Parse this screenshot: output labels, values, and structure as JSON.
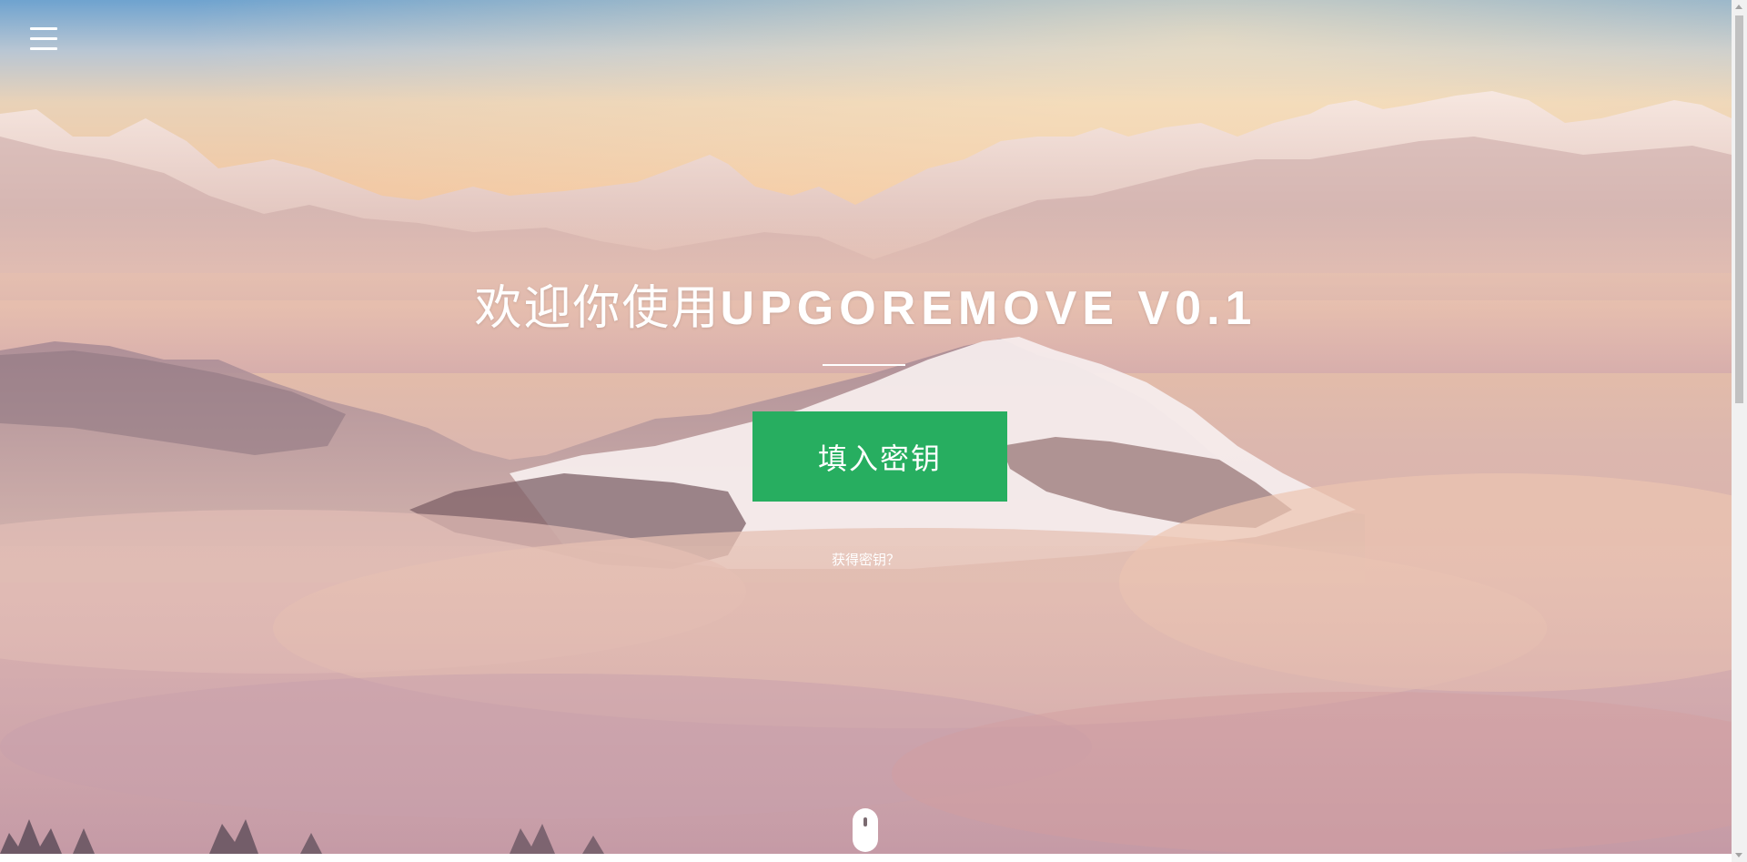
{
  "header": {
    "menu_icon": "hamburger-menu-icon"
  },
  "hero": {
    "title_cn": "欢迎你使用",
    "title_en": "UPGOREMOVE V0.1",
    "cta_label": "填入密钥",
    "get_key_link": "获得密钥？",
    "scroll_icon": "mouse-scroll-icon"
  },
  "colors": {
    "cta_background": "#27ae60",
    "text": "#ffffff"
  }
}
